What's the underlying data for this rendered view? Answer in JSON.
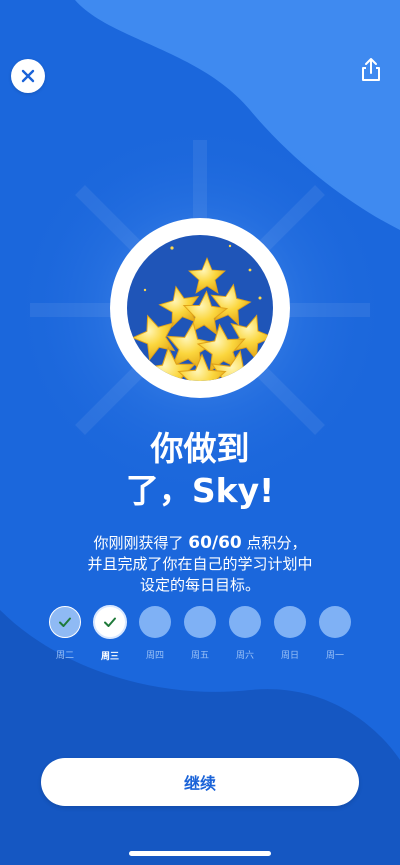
{
  "header": {
    "close_icon": "close-icon",
    "share_icon": "share-icon"
  },
  "medal": {
    "icon": "stars-pile-icon"
  },
  "title": {
    "line1": "你做到",
    "line2": "了，Sky!"
  },
  "message": {
    "before": "你刚刚获得了 ",
    "points": "60/60",
    "after": " 点积分，并且完成了你在自己的学习计划中设定的每日目标。"
  },
  "week": {
    "days": [
      {
        "label": "周二",
        "state": "done"
      },
      {
        "label": "周三",
        "state": "today"
      },
      {
        "label": "周四",
        "state": "pending"
      },
      {
        "label": "周五",
        "state": "pending"
      },
      {
        "label": "周六",
        "state": "pending"
      },
      {
        "label": "周日",
        "state": "pending"
      },
      {
        "label": "周一",
        "state": "pending"
      }
    ]
  },
  "continue_button": "继续",
  "colors": {
    "background": "#1b67dc",
    "wave_light": "#3f8af0",
    "wave_dark": "#1557c2",
    "button_text": "#1a63d8",
    "check": "#1f7a3a"
  }
}
